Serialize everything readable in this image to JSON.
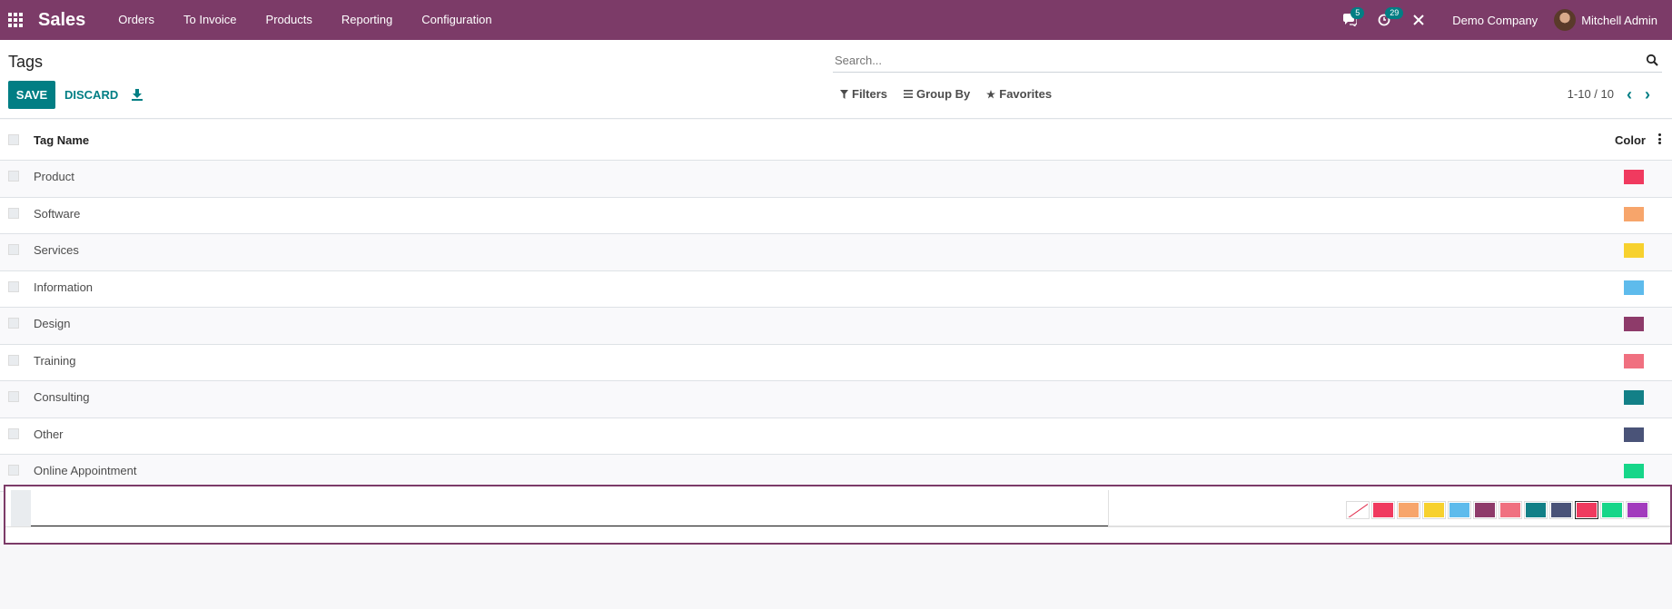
{
  "navbar": {
    "app_name": "Sales",
    "menu": [
      "Orders",
      "To Invoice",
      "Products",
      "Reporting",
      "Configuration"
    ],
    "messages_count": "5",
    "activities_count": "29",
    "company": "Demo Company",
    "user": "Mitchell Admin"
  },
  "control": {
    "title": "Tags",
    "save_label": "SAVE",
    "discard_label": "DISCARD",
    "search_placeholder": "Search...",
    "filters_label": "Filters",
    "groupby_label": "Group By",
    "favorites_label": "Favorites",
    "pager": "1-10 / 10"
  },
  "table": {
    "col_name": "Tag Name",
    "col_color": "Color",
    "rows": [
      {
        "name": "Product",
        "color": "#f03a5f"
      },
      {
        "name": "Software",
        "color": "#f7a56b"
      },
      {
        "name": "Services",
        "color": "#f7d12e"
      },
      {
        "name": "Information",
        "color": "#5ebbec"
      },
      {
        "name": "Design",
        "color": "#8e3b6a"
      },
      {
        "name": "Training",
        "color": "#f07080"
      },
      {
        "name": "Consulting",
        "color": "#138087"
      },
      {
        "name": "Other",
        "color": "#4a5378"
      },
      {
        "name": "Online Appointment",
        "color": "#17d689"
      }
    ]
  },
  "edit_row": {
    "value": "",
    "palette": [
      {
        "name": "no-color",
        "color": "#ffffff"
      },
      {
        "name": "red",
        "color": "#f03a5f"
      },
      {
        "name": "orange",
        "color": "#f7a56b"
      },
      {
        "name": "yellow",
        "color": "#f7d12e"
      },
      {
        "name": "light-blue",
        "color": "#5ebbec"
      },
      {
        "name": "dark-purple",
        "color": "#8e3b6a"
      },
      {
        "name": "salmon-pink",
        "color": "#f07080"
      },
      {
        "name": "medium-blue",
        "color": "#138087"
      },
      {
        "name": "dark-blue",
        "color": "#4a5378"
      },
      {
        "name": "fuchsia",
        "color": "#f03a5f"
      },
      {
        "name": "green",
        "color": "#17d689"
      },
      {
        "name": "purple",
        "color": "#a23bbd"
      }
    ],
    "selected_index": 9
  }
}
